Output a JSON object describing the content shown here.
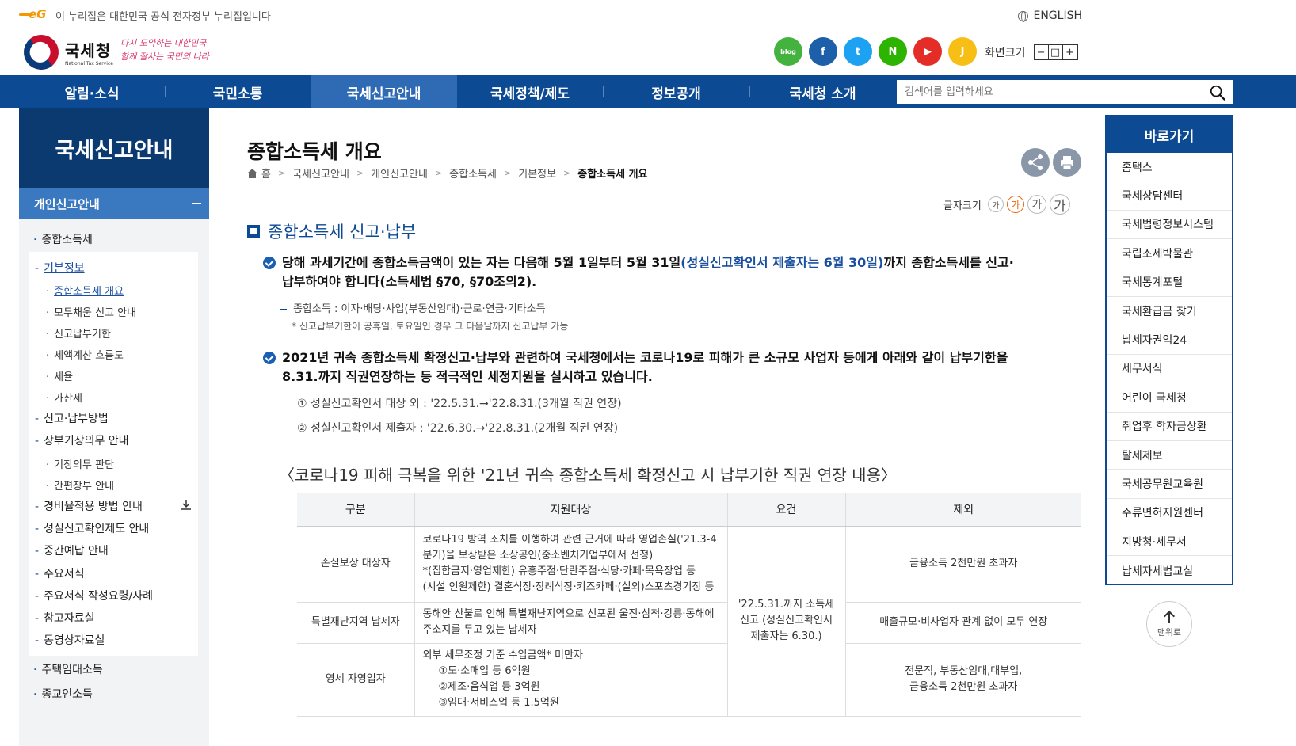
{
  "gov_bar": {
    "eg": "eG",
    "notice": "이 누리집은 대한민국 공식 전자정부 누리집입니다",
    "english": "ENGLISH"
  },
  "logo": {
    "name": "국세청",
    "english": "National Tax Service",
    "slogan_line1": "다시 도약하는 대한민국",
    "slogan_line2": "함께 잘사는 국민의 나라"
  },
  "sns": [
    {
      "name": "blog-icon",
      "label": "blog",
      "color": "#43b23f"
    },
    {
      "name": "facebook-icon",
      "label": "f",
      "color": "#1d5fa8"
    },
    {
      "name": "twitter-icon",
      "label": "t",
      "color": "#1da1f2"
    },
    {
      "name": "naver-post-icon",
      "label": "N",
      "color": "#2db400"
    },
    {
      "name": "youtube-icon",
      "label": "▶",
      "color": "#e52d27"
    },
    {
      "name": "kakao-story-icon",
      "label": "J",
      "color": "#f7be16"
    }
  ],
  "screen_size": {
    "label": "화면크기",
    "minus": "−",
    "reset": "□",
    "plus": "+"
  },
  "nav": {
    "items": [
      "알림·소식",
      "국민소통",
      "국세신고안내",
      "국세정책/제도",
      "정보공개",
      "국세청 소개"
    ],
    "search_placeholder": "검색어를 입력하세요"
  },
  "left_sidebar": {
    "title": "국세신고안내",
    "sub": "개인신고안내",
    "items": [
      {
        "label": "종합소득세",
        "bullet": "·"
      },
      {
        "label": "기본정보",
        "bullet": "-"
      },
      {
        "label": "종합소득세 개요",
        "bullet": "·"
      },
      {
        "label": "모두채움 신고 안내",
        "bullet": "·"
      },
      {
        "label": "신고납부기한",
        "bullet": "·"
      },
      {
        "label": "세액계산 흐름도",
        "bullet": "·"
      },
      {
        "label": "세율",
        "bullet": "·"
      },
      {
        "label": "가산세",
        "bullet": "·"
      },
      {
        "label": "신고·납부방법",
        "bullet": "-"
      },
      {
        "label": "장부기장의무 안내",
        "bullet": "-"
      },
      {
        "label": "기장의무 판단",
        "bullet": "·"
      },
      {
        "label": "간편장부 안내",
        "bullet": "·"
      },
      {
        "label": "경비율적용 방법 안내",
        "bullet": "-"
      },
      {
        "label": "성실신고확인제도 안내",
        "bullet": "-"
      },
      {
        "label": "중간예납 안내",
        "bullet": "-"
      },
      {
        "label": "주요서식",
        "bullet": "-"
      },
      {
        "label": "주요서식 작성요령/사례",
        "bullet": "-"
      },
      {
        "label": "참고자료실",
        "bullet": "-"
      },
      {
        "label": "동영상자료실",
        "bullet": "-"
      },
      {
        "label": "주택임대소득",
        "bullet": "·"
      },
      {
        "label": "종교인소득",
        "bullet": "·"
      }
    ]
  },
  "main": {
    "title": "종합소득세 개요",
    "breadcrumb": [
      "홈",
      "국세신고안내",
      "개인신고안내",
      "종합소득세",
      "기본정보",
      "종합소득세 개요"
    ],
    "fontsize": {
      "label": "글자크기",
      "s1": "가",
      "s2": "가",
      "s3": "가",
      "s4": "가"
    },
    "section_title": "종합소득세 신고·납부",
    "para1": {
      "a": "당해 과세기간에 종합소득금액이 있는 자는 다음해 5월 1일부터 5월 31일",
      "b": "(성실신고확인서 제출자는 6월 30일)",
      "c": "까지 종합소득세를 신고·",
      "d": "납부하여야 합니다(소득세법 §70, §70조의2)."
    },
    "note1": "종합소득 : 이자·배당·사업(부동산임대)·근로·연금·기타소득",
    "note2": "* 신고납부기한이 공휴일, 토요일인 경우 그 다음날까지 신고납부 가능",
    "para2": {
      "a": "2021년 귀속 종합소득세 확정신고·납부와 관련하여 국세청에서는 코로나19로 피해가 큰 소규모 사업자 등에게 아래와 같이 납부기한을",
      "b": "8.31.까지 직권연장하는 등 적극적인 세정지원을 실시하고 있습니다."
    },
    "ext1": "① 성실신고확인서 대상 외 : '22.5.31.→'22.8.31.(3개월 직권 연장)",
    "ext2": "② 성실신고확인서 제출자 : '22.6.30.→'22.8.31.(2개월 직권 연장)",
    "caption": "〈코로나19 피해 극복을 위한 '21년 귀속 종합소득세 확정신고 시 납부기한 직권 연장 내용〉",
    "table": {
      "headers": [
        "구분",
        "지원대상",
        "요건",
        "제외"
      ],
      "r1": {
        "c1": "손실보상 대상자",
        "c2a": "코로나19 방역 조치를 이행하여 관련 근거에 따라 영업손실('21.3-4분기)을 보상받은 소상공인(중소벤처기업부에서 선정)",
        "c2b": "*(집합금지·영업제한) 유흥주점·단란주점·식당·카페·목욕장업 등",
        "c2c": "(시설 인원제한) 결혼식장·장례식장·키즈카페·(실외)스포츠경기장 등",
        "c4": "금융소득 2천만원 초과자"
      },
      "req": "'22.5.31.까지 소득세 신고 (성실신고확인서 제출자는 6.30.)",
      "r2": {
        "c1": "특별재난지역 납세자",
        "c2": "동해안 산불로 인해 특별재난지역으로 선포된 울진·삼척·강릉·동해에 주소지를 두고 있는 납세자",
        "c4": "매출규모·비사업자 관계 없이 모두 연장"
      },
      "r3": {
        "c1": "영세 자영업자",
        "c2a": "외부 세무조정 기준 수입금액* 미만자",
        "c2b": "①도·소매업 등 6억원",
        "c2c": "②제조·음식업 등 3억원",
        "c2d": "③임대·서비스업 등 1.5억원",
        "c4a": "전문직, 부동산임대,대부업,",
        "c4b": "금융소득 2천만원 초과자"
      }
    }
  },
  "quick": {
    "title": "바로가기",
    "items": [
      "홈택스",
      "국세상담센터",
      "국세법령정보시스템",
      "국립조세박물관",
      "국세통계포털",
      "국세환급금 찾기",
      "납세자권익24",
      "세무서식",
      "어린이 국세청",
      "취업후 학자금상환",
      "탈세제보",
      "국세공무원교육원",
      "주류면허지원센터",
      "지방청·세무서",
      "납세자세법교실"
    ],
    "top": "맨위로"
  }
}
